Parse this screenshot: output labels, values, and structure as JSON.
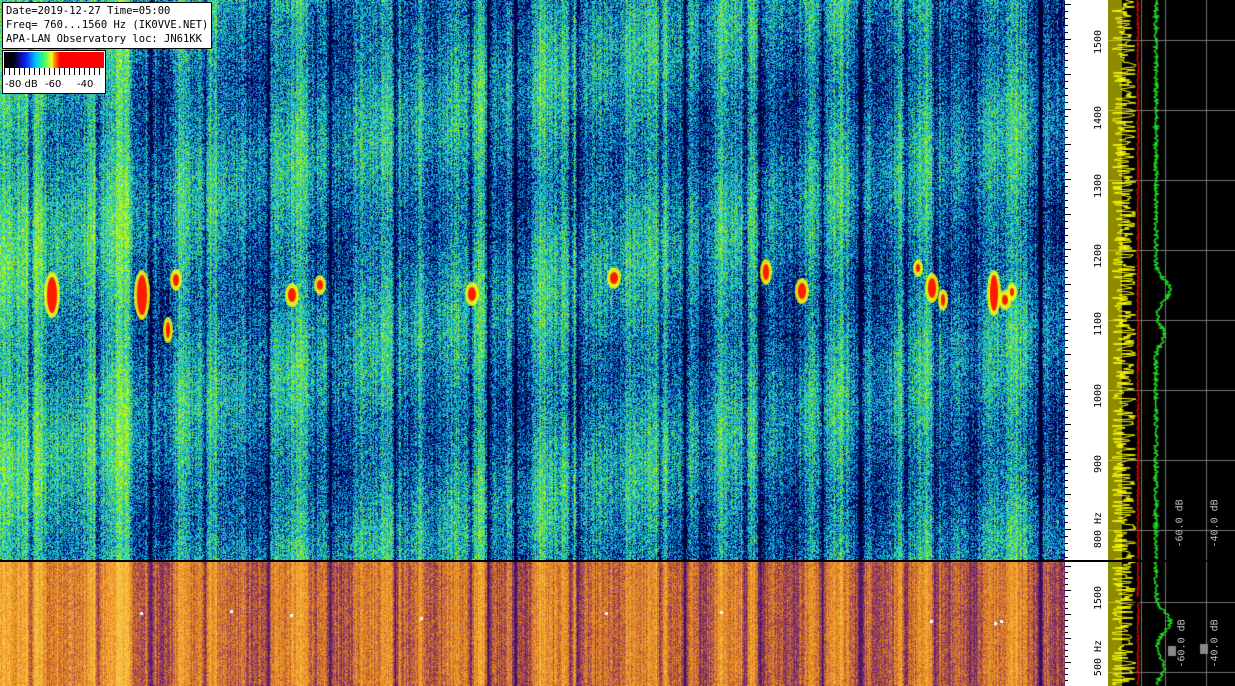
{
  "info": {
    "line1": "Date=2019-12-27 Time=05:00",
    "line2": "Freq= 760...1560 Hz (IK0VVE.NET)",
    "line3": "APA-LAN Observatory loc: JN61KK"
  },
  "legend": {
    "l1": "-80 dB",
    "l2": "-60",
    "l3": "-40"
  },
  "axis_top": {
    "labels": [
      "1500",
      "1400",
      "1300",
      "1200",
      "1100",
      "1000",
      "900",
      "800 Hz"
    ]
  },
  "axis_bottom": {
    "labels": [
      "1500",
      "500 Hz"
    ]
  },
  "spectrum_top": {
    "db_labels": [
      "-60.0 dB",
      "-40.0 dB"
    ]
  },
  "spectrum_bottom": {
    "db_labels": [
      "-60.0 dB",
      "-40.0 dB"
    ]
  },
  "colors": {
    "waterfall_top": "#1e64c8",
    "waterfall_bottom": "#e0a030",
    "spectrum_yellow": "#ffff00",
    "spectrum_green": "#22dd22",
    "marker_red": "#ff0000"
  }
}
